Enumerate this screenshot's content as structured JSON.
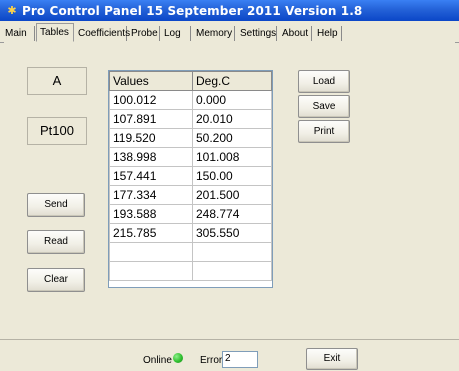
{
  "window": {
    "title": "Pro Control Panel 15 September 2011 Version 1.8"
  },
  "tabs": [
    {
      "label": "Main"
    },
    {
      "label": "Tables"
    },
    {
      "label": "Coefficients"
    },
    {
      "label": "Probe"
    },
    {
      "label": "Log"
    },
    {
      "label": "Memory"
    },
    {
      "label": "Settings"
    },
    {
      "label": "About"
    },
    {
      "label": "Help"
    }
  ],
  "active_tab": "Tables",
  "left_panel": {
    "channel_label": "A",
    "sensor_type": "Pt100",
    "send_label": "Send",
    "read_label": "Read",
    "clear_label": "Clear"
  },
  "table": {
    "headers": [
      "Values",
      "Deg.C"
    ],
    "rows": [
      [
        "100.012",
        "0.000"
      ],
      [
        "107.891",
        "20.010"
      ],
      [
        "119.520",
        "50.200"
      ],
      [
        "138.998",
        "101.008"
      ],
      [
        "157.441",
        "150.00"
      ],
      [
        "177.334",
        "201.500"
      ],
      [
        "193.588",
        "248.774"
      ],
      [
        "215.785",
        "305.550"
      ],
      [
        "",
        ""
      ],
      [
        "",
        ""
      ]
    ]
  },
  "right_panel": {
    "load_label": "Load",
    "save_label": "Save",
    "print_label": "Print"
  },
  "status": {
    "online_label": "Online",
    "online_color": "#2fbf2f",
    "error_label": "Error",
    "error_value": "2",
    "exit_label": "Exit"
  },
  "icons": {
    "app": "app-icon"
  }
}
